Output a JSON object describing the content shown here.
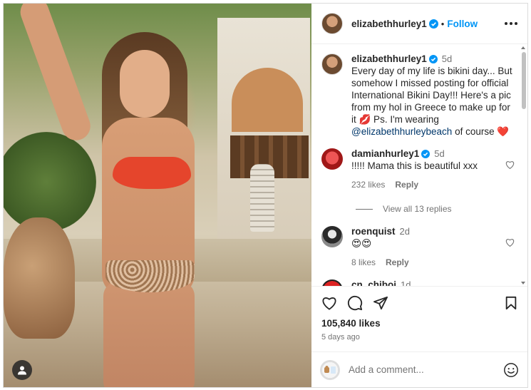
{
  "post": {
    "author": "elizabethhurley1",
    "follow_label": "Follow",
    "separator": "•"
  },
  "caption": {
    "username": "elizabethhurley1",
    "time": "5d",
    "text": "Every day of my life is bikini day... But somehow I missed posting for official International Bikini Day!!! Here's a pic from my hol in Greece to make up for it 💋 Ps. I'm wearing",
    "mention": "@elizabethhurleybeach",
    "text_end": "of course ❤️"
  },
  "comments": [
    {
      "username": "damianhurley1",
      "time": "5d",
      "text": "!!!!! Mama this is beautiful xxx",
      "likes": "232 likes",
      "reply_label": "Reply",
      "view_replies": "View all 13 replies",
      "verified": true
    },
    {
      "username": "roenquist",
      "time": "2d",
      "text": "😍😍",
      "likes": "8 likes",
      "reply_label": "Reply",
      "verified": false
    },
    {
      "username": "cn_chiboi",
      "time": "1d",
      "text": "😂😂😂",
      "verified": false
    }
  ],
  "actions": {
    "likes_count": "105,840 likes",
    "posted_ago": "5 days ago"
  },
  "add_comment": {
    "placeholder": "Add a comment..."
  },
  "colors": {
    "accent": "#0095f6",
    "verified": "#0095f6",
    "heart_red": "#e0245e"
  },
  "icons": [
    "verified-icon",
    "more-icon",
    "heart-icon",
    "comment-icon",
    "share-icon",
    "bookmark-icon",
    "emoji-icon",
    "user-tag-icon"
  ]
}
